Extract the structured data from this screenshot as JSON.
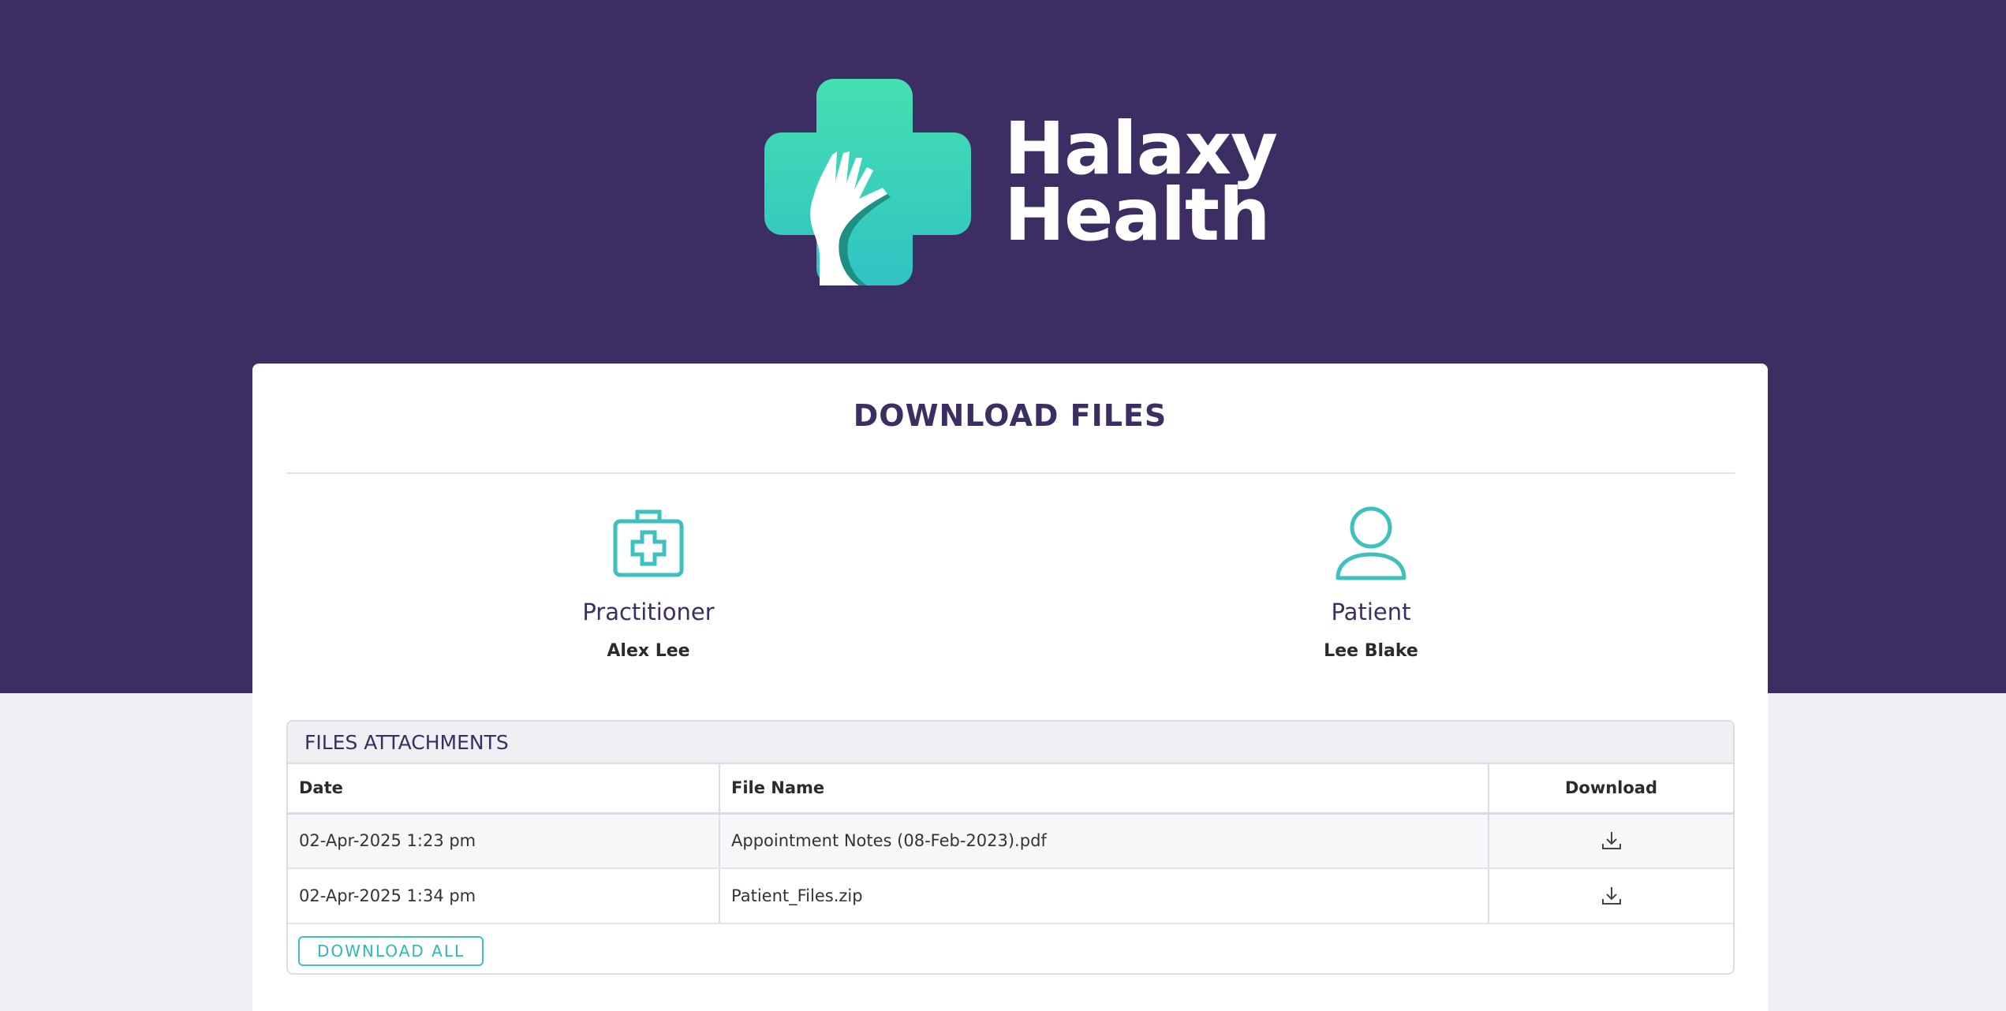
{
  "brand": {
    "name_line1": "Halaxy",
    "name_line2": "Health",
    "logo_icon": "medical-cross-hand-icon",
    "colors": {
      "band": "#3c2d63",
      "accent": "#3cc1bd",
      "cross_top": "#44e0b0",
      "cross_bottom": "#2fc3c3"
    }
  },
  "page": {
    "title": "DOWNLOAD FILES"
  },
  "practitioner": {
    "role": "Practitioner",
    "name": "Alex Lee",
    "icon": "medical-kit-icon"
  },
  "patient": {
    "role": "Patient",
    "name": "Lee Blake",
    "icon": "person-icon"
  },
  "files": {
    "heading": "FILES ATTACHMENTS",
    "columns": [
      "Date",
      "File Name",
      "Download"
    ],
    "rows": [
      {
        "date": "02-Apr-2025 1:23 pm",
        "file_name": "Appointment Notes (08-Feb-2023).pdf",
        "icon": "download-icon"
      },
      {
        "date": "02-Apr-2025 1:34 pm",
        "file_name": "Patient_Files.zip",
        "icon": "download-icon"
      }
    ],
    "download_all_label": "DOWNLOAD ALL"
  }
}
